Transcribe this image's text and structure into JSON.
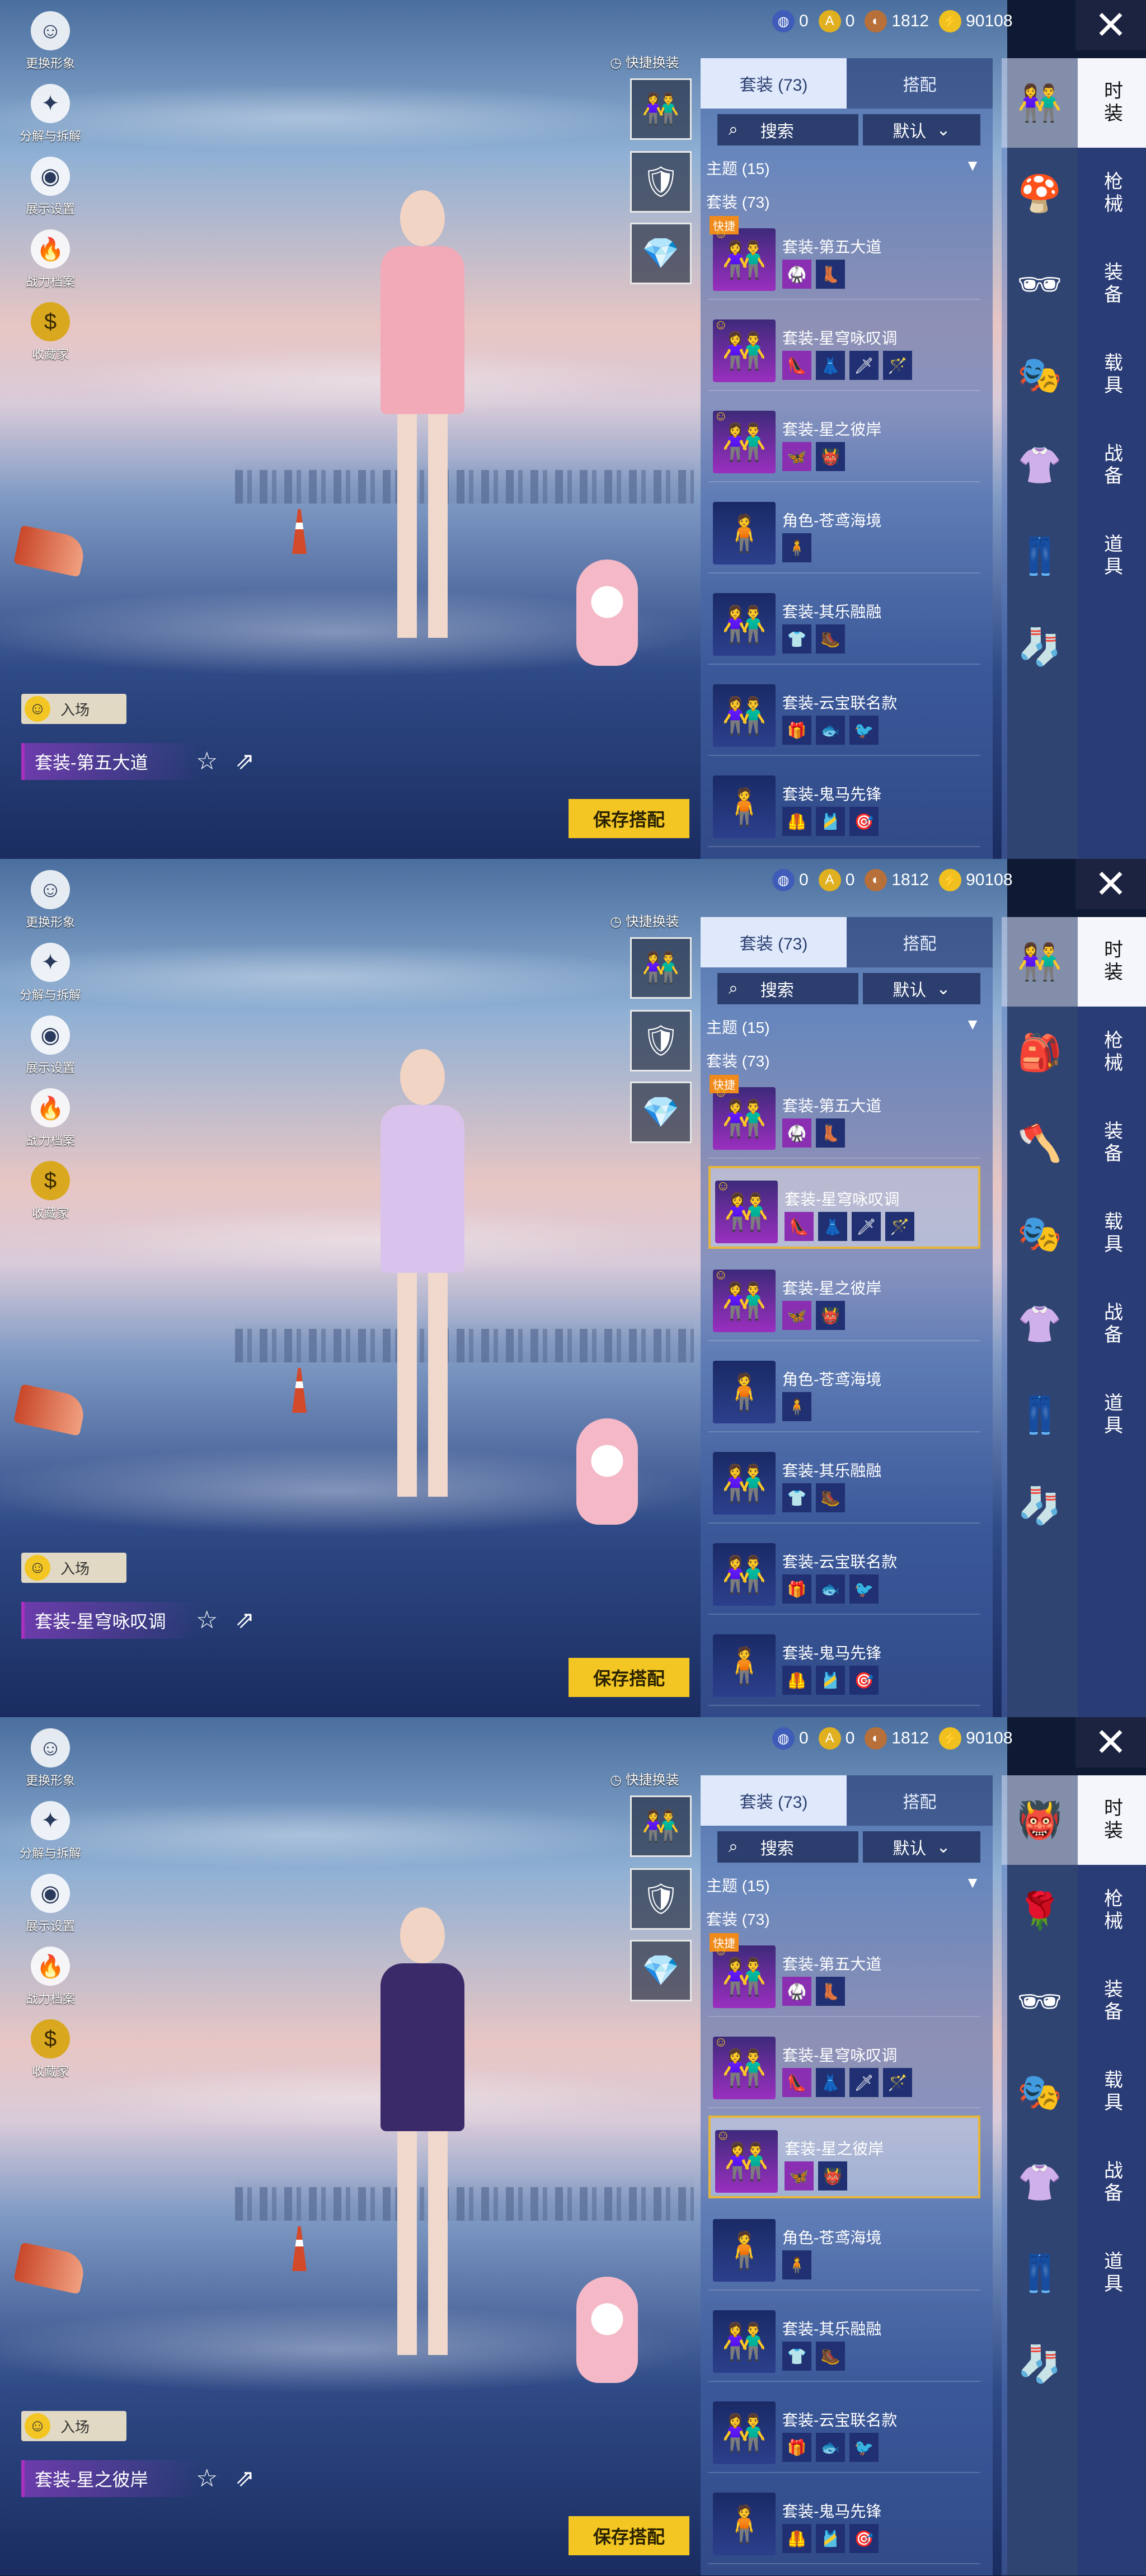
{
  "left_menu": [
    {
      "label": "更换形象",
      "icon": "avatar-icon"
    },
    {
      "label": "分解与拆解",
      "icon": "puzzle-icon"
    },
    {
      "label": "展示设置",
      "icon": "eye-icon"
    },
    {
      "label": "战力档案",
      "icon": "flame-icon"
    },
    {
      "label": "收藏家",
      "icon": "collector-badge-icon"
    }
  ],
  "currency": [
    {
      "value": "0",
      "icon": "globe-coin-icon",
      "color": "#3f5db8"
    },
    {
      "value": "0",
      "icon": "ag-coin-icon",
      "color": "#e0b020"
    },
    {
      "value": "1812",
      "icon": "bronze-coin-icon",
      "color": "#b8703a"
    },
    {
      "value": "90108",
      "icon": "bolt-coin-icon",
      "color": "#f0c020"
    }
  ],
  "close_symbol": "✕",
  "quick_swap_label": "快捷换装",
  "entry_label": "入场",
  "save_label": "保存搭配",
  "panel": {
    "tab_suits": "套装 (73)",
    "tab_match": "搭配",
    "search_label": "搜索",
    "sort_label": "默认",
    "theme_label": "主题 (15)",
    "suits_label": "套装 (73)",
    "fast_tag": "快捷"
  },
  "items": [
    {
      "name": "套装-第五大道",
      "parts": [
        "🥋",
        "👢"
      ]
    },
    {
      "name": "套装-星穹咏叹调",
      "parts": [
        "👠",
        "👗",
        "🗡",
        "🪄"
      ]
    },
    {
      "name": "套装-星之彼岸",
      "parts": [
        "🦋",
        "👹"
      ]
    },
    {
      "name": "角色-苍鸢海境",
      "parts": [
        "🧍"
      ]
    },
    {
      "name": "套装-其乐融融",
      "parts": [
        "👕",
        "🥾"
      ]
    },
    {
      "name": "套装-云宝联名款",
      "parts": [
        "🎁",
        "🐟",
        "🐦"
      ]
    },
    {
      "name": "套装-鬼马先锋",
      "parts": [
        "🦺",
        "🎽",
        "🎯"
      ]
    }
  ],
  "side_tabs": [
    "时装",
    "枪械",
    "装备",
    "载具",
    "战备",
    "道具"
  ],
  "screens": [
    {
      "outfit_name": "套装-第五大道",
      "selected_index": -1,
      "outfit_color": "#f2a9b8",
      "category_icons": [
        "👫",
        "🍄",
        "🕶",
        "🎭",
        "👚",
        "👖",
        "🧦"
      ]
    },
    {
      "outfit_name": "套装-星穹咏叹调",
      "selected_index": 1,
      "outfit_color": "#d9c3ec",
      "category_icons": [
        "👫",
        "🎒",
        "🪓",
        "🎭",
        "👚",
        "👖",
        "🧦"
      ]
    },
    {
      "outfit_name": "套装-星之彼岸",
      "selected_index": 2,
      "outfit_color": "#3a2a6a",
      "category_icons": [
        "👹",
        "🌹",
        "🕶",
        "🎭",
        "👚",
        "👖",
        "🧦"
      ]
    }
  ]
}
